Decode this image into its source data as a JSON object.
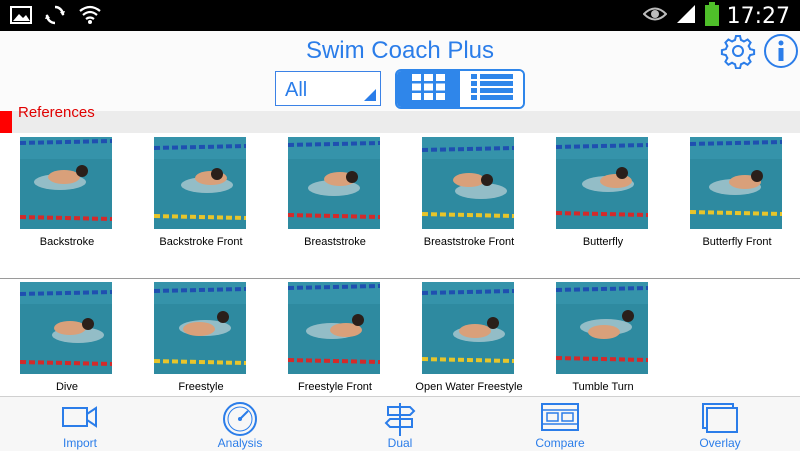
{
  "status_bar": {
    "time": "17:27"
  },
  "app": {
    "title": "Swim Coach Plus"
  },
  "filter": {
    "selected": "All"
  },
  "section": {
    "label": "References"
  },
  "references": [
    {
      "label": "Backstroke"
    },
    {
      "label": "Backstroke Front"
    },
    {
      "label": "Breaststroke"
    },
    {
      "label": "Breaststroke Front"
    },
    {
      "label": "Butterfly"
    },
    {
      "label": "Butterfly Front"
    },
    {
      "label": "Dive"
    },
    {
      "label": "Freestyle"
    },
    {
      "label": "Freestyle Front"
    },
    {
      "label": "Open Water Freestyle"
    },
    {
      "label": "Tumble Turn"
    }
  ],
  "bottom_nav": [
    {
      "label": "Import",
      "icon": "video-camera-icon"
    },
    {
      "label": "Analysis",
      "icon": "gauge-icon"
    },
    {
      "label": "Dual",
      "icon": "signpost-icon"
    },
    {
      "label": "Compare",
      "icon": "filmstrip-icon"
    },
    {
      "label": "Overlay",
      "icon": "overlay-icon"
    }
  ],
  "colors": {
    "accent": "#2b7de9",
    "section_marker": "#ff0000",
    "pool_water": "#2e8aa0",
    "lane_rope_red": "#d42a2a",
    "lane_rope_blue": "#1f4fb0",
    "lane_rope_yellow": "#e7c52a"
  }
}
